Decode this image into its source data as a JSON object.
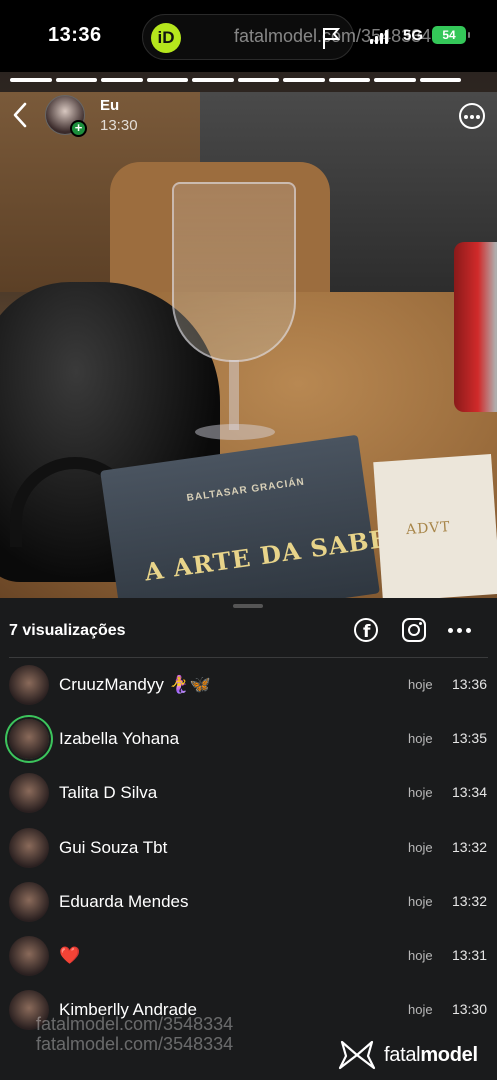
{
  "status_bar": {
    "time": "13:36",
    "app_badge": "iD",
    "network": "5G",
    "battery": "54"
  },
  "watermark": {
    "top_text": "fatalmodel.com/3548334",
    "bottom_text": "fatalmodel.com/3548334",
    "logo_light": "fatal",
    "logo_bold": "model"
  },
  "story": {
    "user": "Eu",
    "time": "13:30",
    "segments_total": 10,
    "segments_viewed": 10,
    "photo_texts": {
      "book_author": "BALTASAR GRACIÁN",
      "book_title": "A ARTE DA SABEDORIA",
      "napkin": "ADVT"
    }
  },
  "viewers_sheet": {
    "count_label": "7 visualizações",
    "viewers": [
      {
        "name": "CruuzMandyy 🧜‍♀️🦋",
        "day": "hoje",
        "time": "13:36",
        "ring": false
      },
      {
        "name": "Izabella Yohana",
        "day": "hoje",
        "time": "13:35",
        "ring": true
      },
      {
        "name": "Talita D Silva",
        "day": "hoje",
        "time": "13:34",
        "ring": false
      },
      {
        "name": "Gui Souza Tbt",
        "day": "hoje",
        "time": "13:32",
        "ring": false
      },
      {
        "name": "Eduarda Mendes",
        "day": "hoje",
        "time": "13:32",
        "ring": false
      },
      {
        "name": "❤️",
        "day": "hoje",
        "time": "13:31",
        "ring": false
      },
      {
        "name": "Kimberlly Andrade",
        "day": "hoje",
        "time": "13:30",
        "ring": false
      }
    ]
  },
  "colors": {
    "online_ring": "#3cc45c",
    "battery": "#34c759",
    "sheet_bg": "#1a1b1c",
    "add_badge": "#1c8f3c"
  }
}
